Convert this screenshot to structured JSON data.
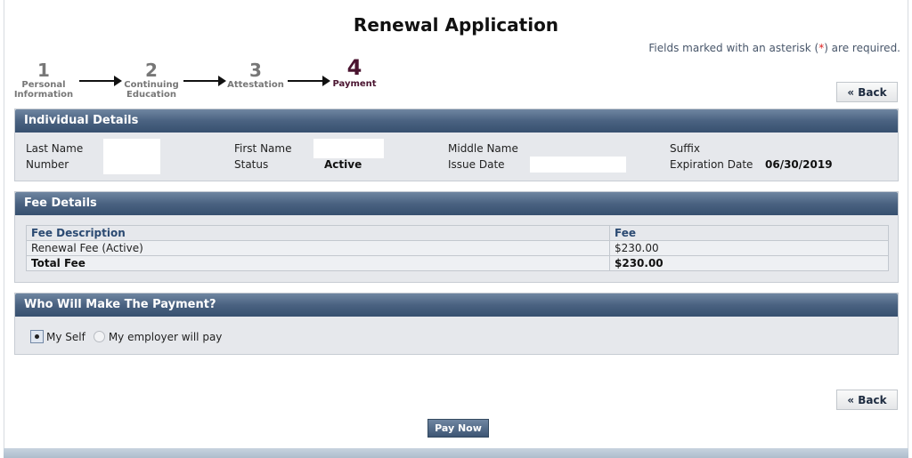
{
  "header": {
    "title": "Renewal Application",
    "required_prefix": "Fields marked with an asterisk (",
    "required_asterisk": "*",
    "required_suffix": ") are required."
  },
  "stepper": {
    "steps": [
      {
        "number": "1",
        "label_line1": "Personal",
        "label_line2": "Information"
      },
      {
        "number": "2",
        "label_line1": "Continuing",
        "label_line2": "Education"
      },
      {
        "number": "3",
        "label_line1": "Attestation",
        "label_line2": ""
      },
      {
        "number": "4",
        "label_line1": "Payment",
        "label_line2": ""
      }
    ],
    "active_step": 4
  },
  "buttons": {
    "back_label": "« Back",
    "pay_now_label": "Pay Now"
  },
  "individual_details": {
    "heading": "Individual Details",
    "last_name_label": "Last Name",
    "number_label": "Number",
    "first_name_label": "First Name",
    "status_label": "Status",
    "status_value": "Active",
    "middle_name_label": "Middle Name",
    "issue_date_label": "Issue Date",
    "suffix_label": "Suffix",
    "expiration_date_label": "Expiration Date",
    "expiration_date_value": "06/30/2019"
  },
  "fee_details": {
    "heading": "Fee Details",
    "columns": [
      "Fee Description",
      "Fee"
    ],
    "rows": [
      {
        "description": "Renewal Fee (Active)",
        "fee": "$230.00"
      }
    ],
    "total": {
      "description": "Total Fee",
      "fee": "$230.00"
    }
  },
  "payment": {
    "heading": "Who Will Make The Payment?",
    "options": [
      {
        "label": "My Self",
        "selected": true
      },
      {
        "label": "My employer will pay",
        "selected": false
      }
    ]
  },
  "colors": {
    "panel_header": "#4a6281",
    "active_step": "#4a1430",
    "asterisk": "#dd2222"
  }
}
